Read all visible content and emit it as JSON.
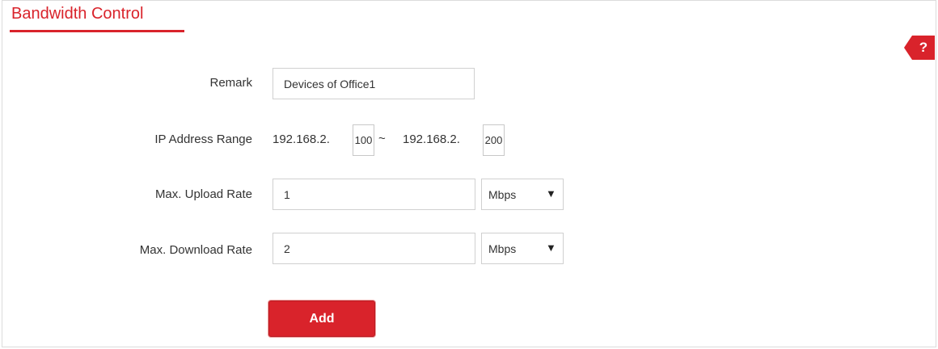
{
  "header": {
    "title": "Bandwidth Control"
  },
  "help": {
    "label": "?"
  },
  "form": {
    "remark": {
      "label": "Remark",
      "value": "Devices of Office1"
    },
    "ip_range": {
      "label": "IP Address Range",
      "prefix_start": "192.168.2.",
      "start_octet": "100",
      "separator": "~",
      "prefix_end": "192.168.2.",
      "end_octet": "200"
    },
    "upload": {
      "label": "Max. Upload Rate",
      "value": "1",
      "unit": "Mbps"
    },
    "download": {
      "label": "Max. Download Rate",
      "value": "2",
      "unit": "Mbps"
    },
    "add_label": "Add"
  },
  "colors": {
    "accent": "#d9232b"
  },
  "icons": {
    "dropdown": "triangle-down-icon"
  }
}
